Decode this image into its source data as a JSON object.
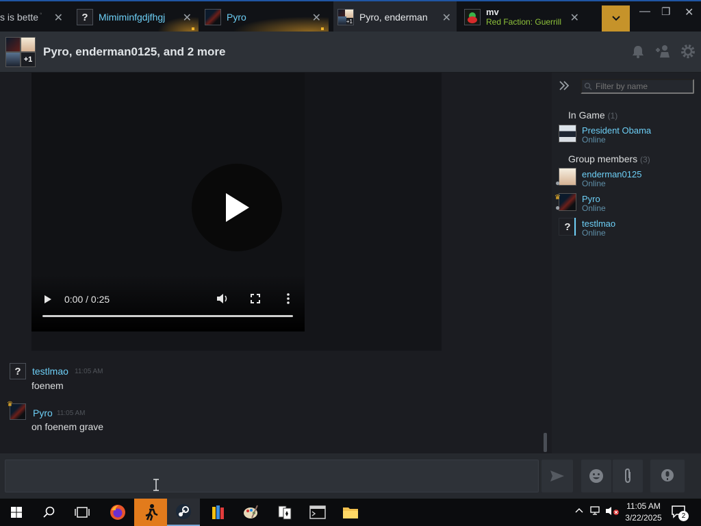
{
  "tabs": [
    {
      "label": "s is bette",
      "unread": true
    },
    {
      "label": "Mimiminfgdjfhgj",
      "unread": true
    },
    {
      "label": "Pyro",
      "unread": true
    },
    {
      "label": "Pyro, enderman",
      "avatar_badge": "+1"
    },
    {
      "label": "mv",
      "sublabel": "Red Faction: Guerrill"
    }
  ],
  "chat": {
    "title": "Pyro, enderman0125, and 2 more",
    "avatar_badge": "+1"
  },
  "video": {
    "time": "0:00 / 0:25",
    "progress": 0
  },
  "messages": [
    {
      "name": "testlmao",
      "time": "11:05 AM",
      "text": "foenem",
      "avatar_char": "?"
    },
    {
      "name": "Pyro",
      "time": "11:05 AM",
      "text": "on foenem grave"
    }
  ],
  "members": {
    "filter_placeholder": "Filter by name",
    "in_game": {
      "label": "In Game",
      "count": "(1)",
      "items": [
        {
          "name": "President Obama",
          "status": "Online"
        }
      ]
    },
    "group": {
      "label": "Group members",
      "count": "(3)",
      "items": [
        {
          "name": "enderman0125",
          "status": "Online"
        },
        {
          "name": "Pyro",
          "status": "Online"
        },
        {
          "name": "testlmao",
          "status": "Online",
          "avatar_char": "?"
        }
      ]
    }
  },
  "input": {
    "value": "",
    "placeholder": ""
  },
  "taskbar": {
    "time": "11:05 AM",
    "date": "3/22/2025",
    "notifications": "2"
  },
  "colors": {
    "accent_blue": "#6dcff6",
    "unread_gold": "#f0b429",
    "dropdown_gold": "#c6932a"
  }
}
